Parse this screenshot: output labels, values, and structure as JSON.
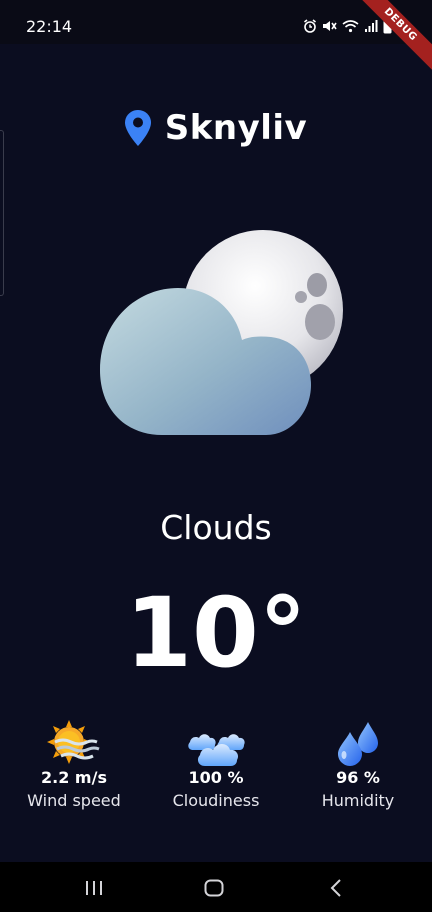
{
  "status_bar": {
    "time": "22:14",
    "icons": [
      "alarm-icon",
      "mute-icon",
      "wifi-icon",
      "signal-icon",
      "battery-icon"
    ]
  },
  "debug_banner": "DEBUG",
  "location": {
    "icon": "location-pin-icon",
    "city": "Sknyliv"
  },
  "weather": {
    "icon": "cloud-moon-icon",
    "condition": "Clouds",
    "temperature": "10°"
  },
  "stats": [
    {
      "icon": "wind-sun-icon",
      "value": "2.2 m/s",
      "label": "Wind speed"
    },
    {
      "icon": "clouds-icon",
      "value": "100 %",
      "label": "Cloudiness"
    },
    {
      "icon": "water-drops-icon",
      "value": "96 %",
      "label": "Humidity"
    }
  ],
  "nav_bar": [
    "recent-apps-icon",
    "home-icon",
    "back-icon"
  ],
  "colors": {
    "background": "#0b0d20",
    "accent_pin": "#3b82f6",
    "text": "#ffffff"
  }
}
